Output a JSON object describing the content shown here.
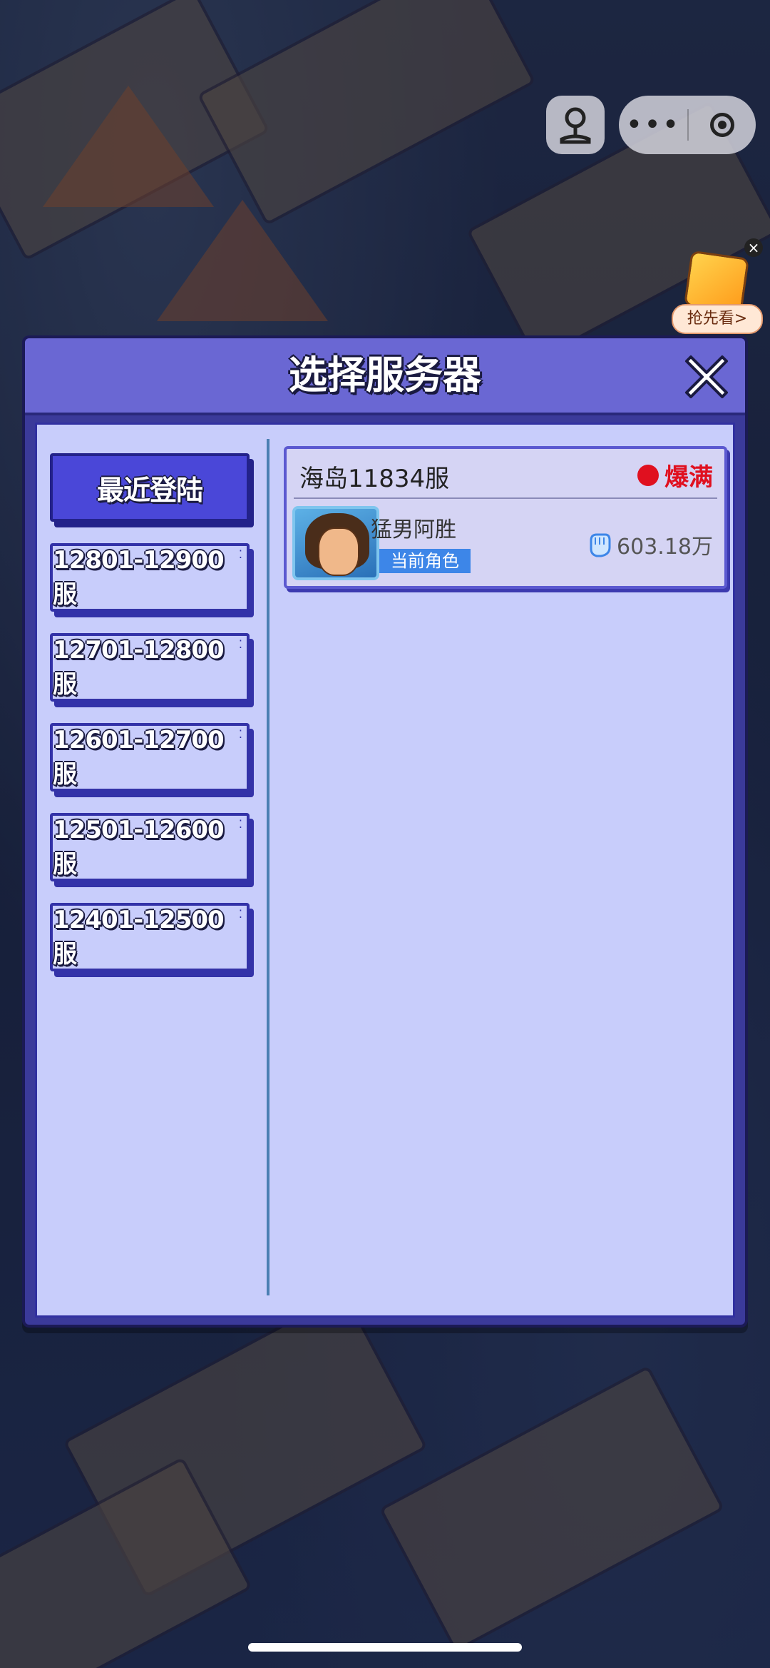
{
  "dialog": {
    "title": "选择服务器"
  },
  "tabs": [
    {
      "label": "最近登陆",
      "active": true
    },
    {
      "label": "12801-12900服",
      "active": false
    },
    {
      "label": "12701-12800服",
      "active": false
    },
    {
      "label": "12601-12700服",
      "active": false
    },
    {
      "label": "12501-12600服",
      "active": false
    },
    {
      "label": "12401-12500服",
      "active": false
    }
  ],
  "server": {
    "name": "海岛11834服",
    "status": "爆满",
    "status_color": "#e0101f",
    "role_name": "猛男阿胜",
    "role_badge": "当前角色",
    "power": "603.18万"
  },
  "promo": {
    "label": "抢先看>"
  },
  "icons": [
    "joystick-icon",
    "more-icon",
    "target-icon",
    "close-icon",
    "power-fist-icon"
  ]
}
